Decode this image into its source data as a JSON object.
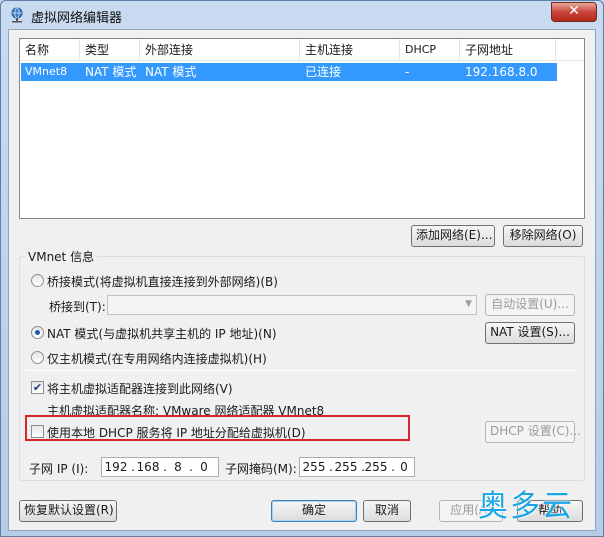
{
  "window": {
    "title": "虚拟网络编辑器",
    "close_glyph": "✕"
  },
  "table": {
    "columns": [
      "名称",
      "类型",
      "外部连接",
      "主机连接",
      "DHCP",
      "子网地址"
    ],
    "rows": [
      {
        "name": "VMnet8",
        "type": "NAT 模式",
        "external": "NAT 模式",
        "host": "已连接",
        "dhcp": "-",
        "subnet": "192.168.8.0"
      }
    ]
  },
  "table_buttons": {
    "add": "添加网络(E)...",
    "remove": "移除网络(O)"
  },
  "vmnet_info": {
    "title": "VMnet 信息",
    "bridge_mode": "桥接模式(将虚拟机直接连接到外部网络)(B)",
    "bridge_to_label": "桥接到(T):",
    "bridge_to_value": "",
    "auto_settings": "自动设置(U)...",
    "nat_mode": "NAT 模式(与虚拟机共享主机的 IP 地址)(N)",
    "nat_settings": "NAT 设置(S)...",
    "host_only": "仅主机模式(在专用网络内连接虚拟机)(H)",
    "connect_adapter": "将主机虚拟适配器连接到此网络(V)",
    "connect_adapter_checked": true,
    "adapter_name": "主机虚拟适配器名称: VMware 网络适配器 VMnet8",
    "use_dhcp": "使用本地 DHCP 服务将 IP 地址分配给虚拟机(D)",
    "use_dhcp_checked": false,
    "dhcp_settings": "DHCP 设置(C)...",
    "subnet_ip_label": "子网 IP (I):",
    "subnet_ip": [
      "192",
      "168",
      "8",
      "0"
    ],
    "subnet_mask_label": "子网掩码(M):",
    "subnet_mask": [
      "255",
      "255",
      "255",
      "0"
    ],
    "selected_mode": "nat"
  },
  "footer": {
    "restore": "恢复默认设置(R)",
    "ok": "确定",
    "cancel": "取消",
    "apply": "应用(A)",
    "help": "帮助"
  },
  "watermark": "奥多云",
  "colors": {
    "selection": "#3399ff",
    "highlight_box": "#d9262c",
    "watermark": "#1aa6e6"
  }
}
